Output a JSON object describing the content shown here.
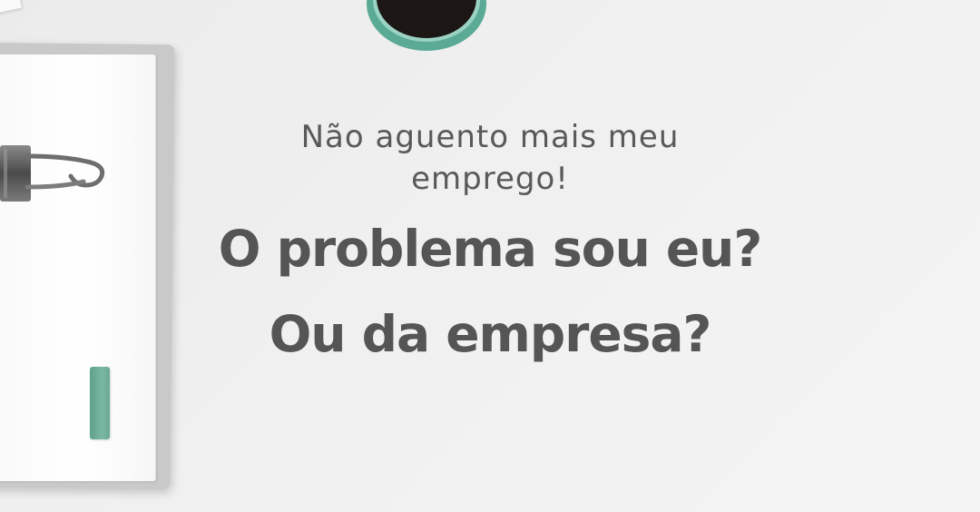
{
  "text": {
    "subtitle_line1": "Não aguento mais meu",
    "subtitle_line2": "emprego!",
    "headline_line1": "O problema sou eu?",
    "headline_line2": "Ou da empresa?"
  },
  "colors": {
    "background": "#efefef",
    "text": "#555555",
    "accent": "#6aa994",
    "coffee_cup": "#5aaa95"
  },
  "icons": {
    "binder_clip": "binder-clip-icon",
    "coffee_cup": "coffee-cup-icon"
  }
}
